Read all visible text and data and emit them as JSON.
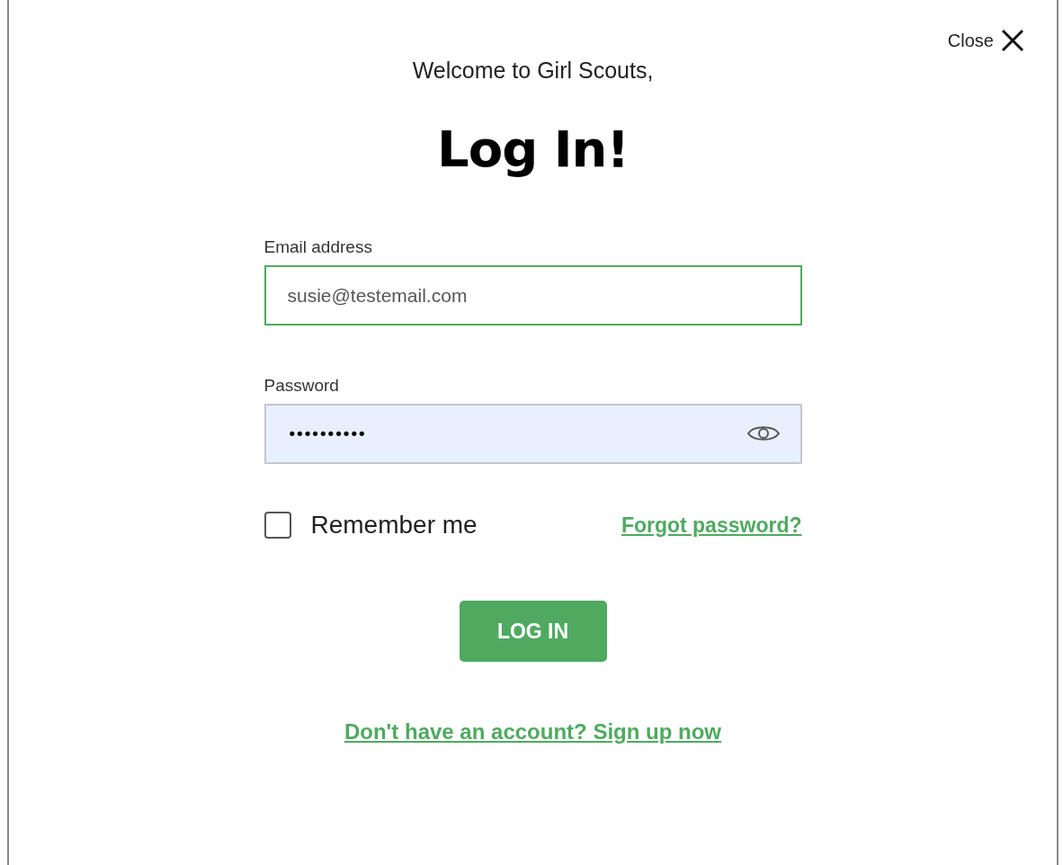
{
  "close": {
    "label": "Close"
  },
  "greeting": "Welcome to Girl Scouts,",
  "title": "Log In!",
  "email": {
    "label": "Email address",
    "value": "susie@testemail.com",
    "focused": true
  },
  "password": {
    "label": "Password",
    "value": "••••••••••",
    "autofilled": true
  },
  "remember": {
    "label": "Remember me",
    "checked": false
  },
  "forgot_link": "Forgot password?",
  "submit": "LOG IN",
  "signup_link": "Don't have an account? Sign up now"
}
